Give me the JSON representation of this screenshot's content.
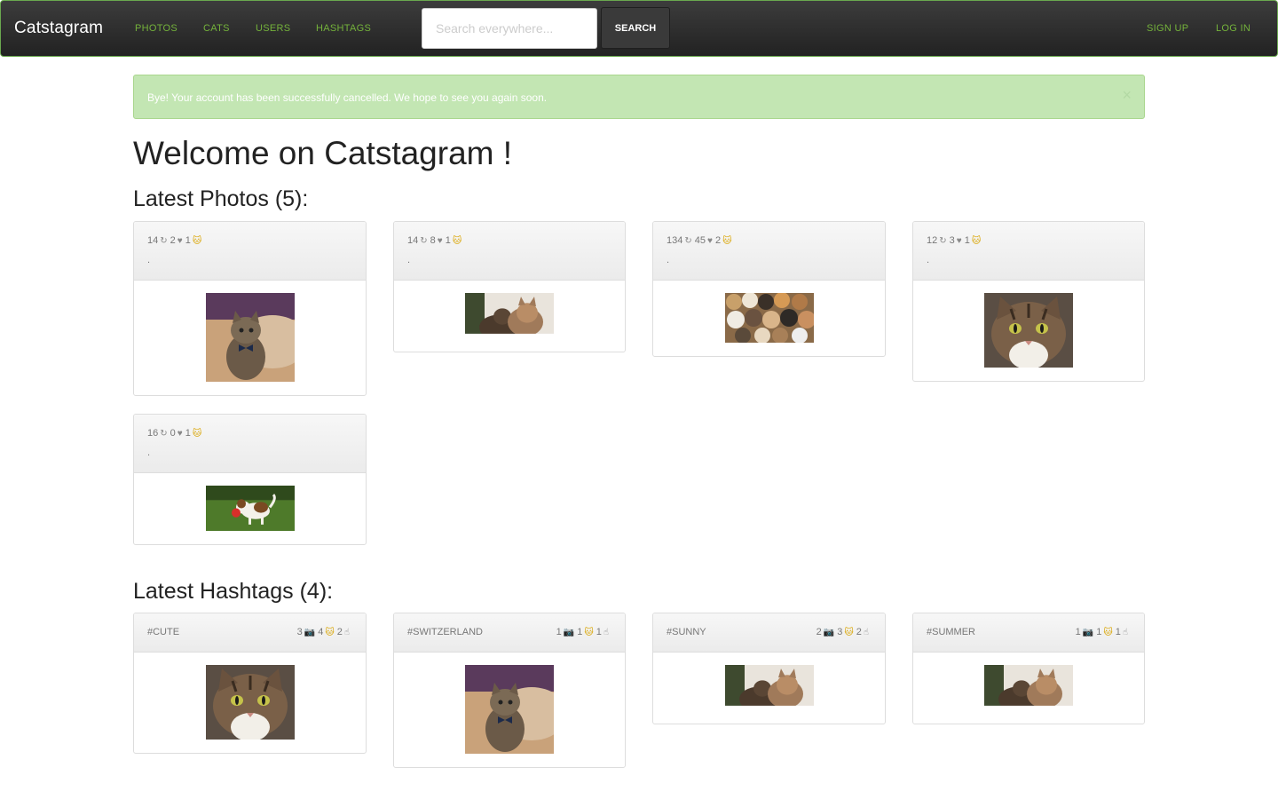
{
  "navbar": {
    "brand": "Catstagram",
    "links": [
      "PHOTOS",
      "CATS",
      "USERS",
      "HASHTAGS"
    ],
    "search_placeholder": "Search everywhere...",
    "search_button": "SEARCH",
    "right_links": [
      "SIGN UP",
      "LOG IN"
    ],
    "accent_color": "#74b23b"
  },
  "alert": {
    "text": "Bye! Your account has been successfully cancelled. We hope to see you again soon.",
    "close": "×"
  },
  "page_title": "Welcome on Catstagram !",
  "photos": {
    "title": "Latest Photos (5):",
    "items": [
      {
        "views": "14",
        "comments": "2",
        "likes": "1",
        "dot": ".",
        "image": "kitten-bowtie"
      },
      {
        "views": "14",
        "comments": "8",
        "likes": "1",
        "dot": ".",
        "image": "two-cats"
      },
      {
        "views": "134",
        "comments": "45",
        "likes": "2",
        "dot": ".",
        "image": "many-cats"
      },
      {
        "views": "12",
        "comments": "3",
        "likes": "1",
        "dot": ".",
        "image": "tabby-face"
      },
      {
        "views": "16",
        "comments": "0",
        "likes": "1",
        "dot": ".",
        "image": "beagle-puppy"
      }
    ]
  },
  "hashtags": {
    "title": "Latest Hashtags (4):",
    "items": [
      {
        "name": "#CUTE",
        "photos": "3",
        "cats": "4",
        "users": "2",
        "image": "tabby-face"
      },
      {
        "name": "#SWITZERLAND",
        "photos": "1",
        "cats": "1",
        "users": "1",
        "image": "kitten-bowtie"
      },
      {
        "name": "#SUNNY",
        "photos": "2",
        "cats": "3",
        "users": "2",
        "image": "two-cats"
      },
      {
        "name": "#SUMMER",
        "photos": "1",
        "cats": "1",
        "users": "1",
        "image": "two-cats"
      }
    ]
  },
  "icons": {
    "views": "refresh-icon",
    "comments": "heart-icon",
    "likes": "cat-icon",
    "photos": "camera-icon",
    "cats": "cat-icon",
    "users": "hand-icon"
  }
}
